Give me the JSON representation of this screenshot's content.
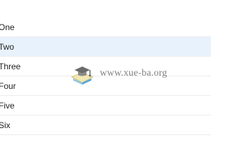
{
  "list": {
    "items": [
      {
        "label": "One",
        "selected": false
      },
      {
        "label": "Two",
        "selected": true
      },
      {
        "label": "Three",
        "selected": false
      },
      {
        "label": "Four",
        "selected": false
      },
      {
        "label": "Five",
        "selected": false
      },
      {
        "label": "Six",
        "selected": false
      }
    ]
  },
  "watermark": {
    "text": "www.xue-ba.org",
    "icon": "graduation-cap-book-logo-icon"
  },
  "colors": {
    "selected_background": "#e8f2fd",
    "text": "#222222",
    "divider": "#ececec",
    "watermark_text": "#6a6a6a"
  }
}
